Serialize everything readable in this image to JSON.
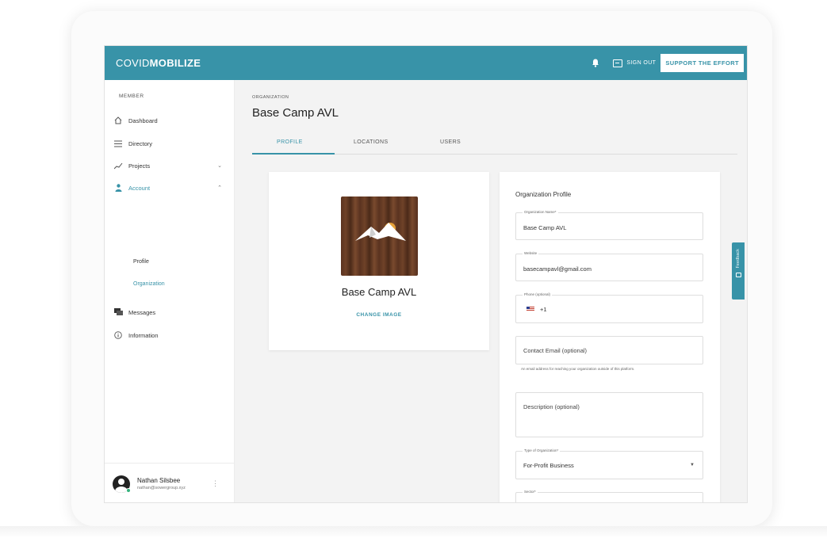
{
  "header": {
    "brand_light": "COVID",
    "brand_bold": "MOBILIZE",
    "sign_out": "SIGN OUT",
    "support_button": "SUPPORT THE EFFORT"
  },
  "sidebar": {
    "section_label": "MEMBER",
    "items": [
      {
        "label": "Dashboard",
        "icon": "home-icon"
      },
      {
        "label": "Directory",
        "icon": "list-icon"
      },
      {
        "label": "Projects",
        "icon": "projects-icon"
      },
      {
        "label": "Account",
        "icon": "person-icon"
      },
      {
        "label": "Messages",
        "icon": "messages-icon"
      },
      {
        "label": "Information",
        "icon": "info-icon"
      }
    ],
    "account_sub": [
      "Profile",
      "Organization"
    ],
    "user": {
      "name": "Nathan Silsbee",
      "email": "nathan@sowergroup.xyz"
    }
  },
  "main": {
    "org_label": "ORGANIZATION",
    "title": "Base Camp AVL",
    "tabs": [
      "PROFILE",
      "LOCATIONS",
      "USERS"
    ],
    "profile_card": {
      "name": "Base Camp AVL",
      "change_image": "CHANGE IMAGE"
    },
    "form": {
      "section_title": "Organization Profile",
      "org_name_label": "Organization Name*",
      "org_name_value": "Base Camp AVL",
      "website_label": "Website",
      "website_value": "basecampavl@gmail.com",
      "phone_label": "Phone (optional)",
      "phone_value": "+1",
      "contact_email_placeholder": "Contact Email (optional)",
      "contact_email_helper": "An email address for reaching your organization outside of this platform.",
      "description_placeholder": "Description (optional)",
      "type_label": "Type of Organization*",
      "type_value": "For-Profit Business",
      "sector_label": "Sector*"
    }
  },
  "feedback": {
    "label": "Feedback"
  },
  "colors": {
    "accent": "#3893a8"
  }
}
